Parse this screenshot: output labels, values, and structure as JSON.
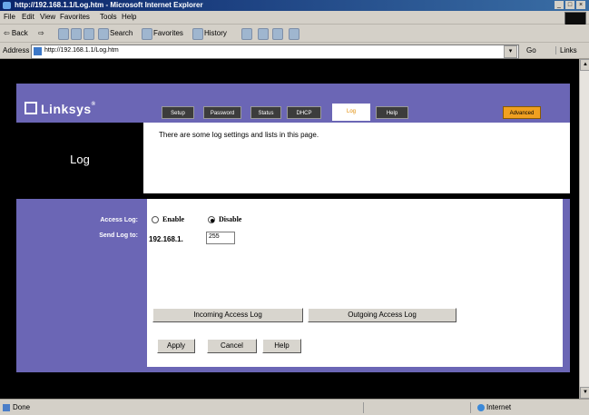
{
  "window": {
    "title": "http://192.168.1.1/Log.htm - Microsoft Internet Explorer",
    "controls": [
      "_",
      "□",
      "×"
    ]
  },
  "menu": [
    "File",
    "Edit",
    "View",
    "Favorites",
    "Tools",
    "Help"
  ],
  "toolbar": {
    "back": "⇦ Back",
    "forward": "⇨",
    "search": "Search",
    "favorites": "Favorites",
    "history": "History"
  },
  "address": {
    "label": "Address",
    "url": "http://192.168.1.1/Log.htm",
    "go": "Go",
    "links": "Links"
  },
  "brand": {
    "name": "Linksys",
    "reg": "®"
  },
  "tabs": [
    {
      "label": "Setup"
    },
    {
      "label": "Password"
    },
    {
      "label": "Status"
    },
    {
      "label": "DHCP"
    },
    {
      "label": "Log",
      "active": true
    },
    {
      "label": "Help"
    },
    {
      "label": "Advanced"
    }
  ],
  "page": {
    "title": "Log",
    "description": "There are some log settings and lists in this page."
  },
  "form": {
    "access_log_label": "Access Log:",
    "send_log_label": "Send Log to:",
    "enable_label": "Enable",
    "disable_label": "Disable",
    "access_log_state": "disable",
    "ip_prefix": "192.168.1.",
    "ip_last_octet": "255"
  },
  "buttons": {
    "incoming": "Incoming Access Log",
    "outgoing": "Outgoing Access Log",
    "apply": "Apply",
    "cancel": "Cancel",
    "help": "Help"
  },
  "status": {
    "text": "Done",
    "zone": "Internet"
  }
}
